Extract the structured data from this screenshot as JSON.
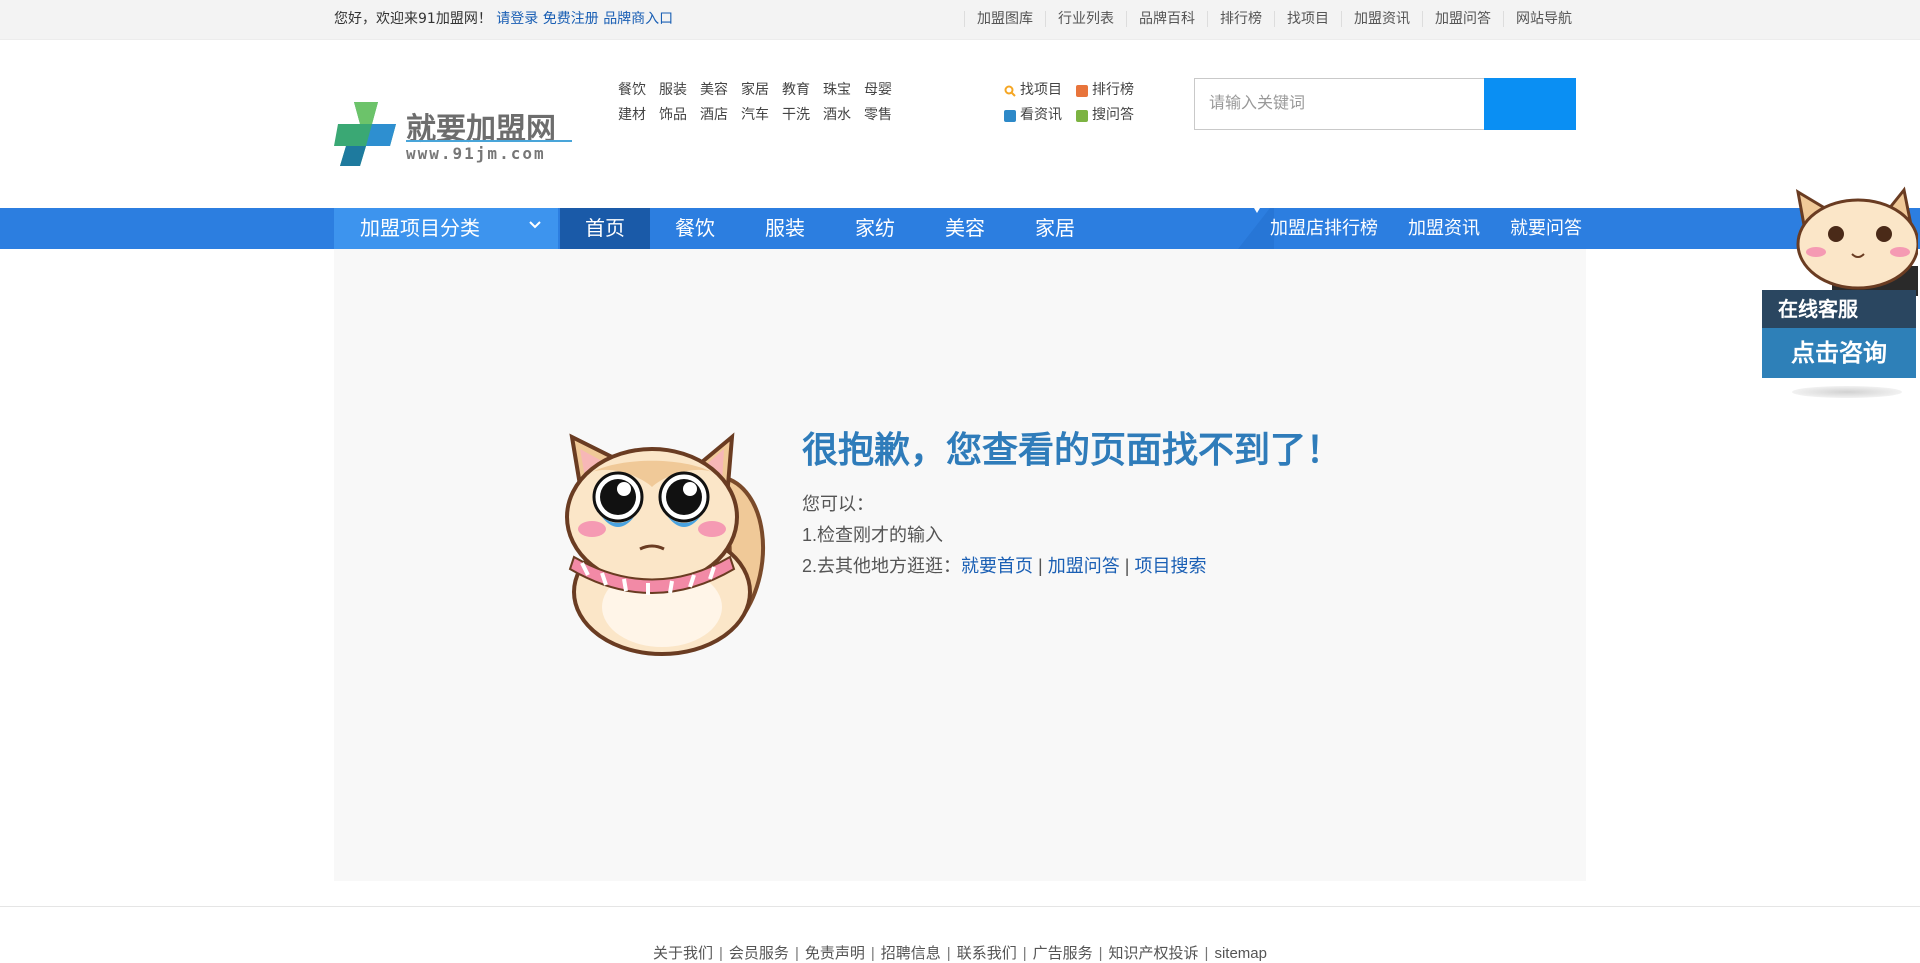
{
  "topbar": {
    "greeting": "您好，欢迎来91加盟网！",
    "login": "请登录",
    "register": "免费注册",
    "brand_entry": "品牌商入口",
    "links": [
      "加盟图库",
      "行业列表",
      "品牌百科",
      "排行榜",
      "找项目",
      "加盟资讯",
      "加盟问答",
      "网站导航"
    ]
  },
  "logo": {
    "text": "就要加盟网",
    "url": "www.91jm.com"
  },
  "categories": {
    "row1": [
      "餐饮",
      "服装",
      "美容",
      "家居",
      "教育",
      "珠宝",
      "母婴"
    ],
    "row2": [
      "建材",
      "饰品",
      "酒店",
      "汽车",
      "干洗",
      "酒水",
      "零售"
    ]
  },
  "quick_links": {
    "find_project": "找项目",
    "ranking": "排行榜",
    "news": "看资讯",
    "qa": "搜问答",
    "icon_colors": [
      "#f5a623",
      "#e8743b",
      "#2d89c8",
      "#7cb342"
    ]
  },
  "search": {
    "placeholder": "请输入关键词",
    "button_color": "#0a8ff3"
  },
  "nav": {
    "category_menu": "加盟项目分类",
    "items": [
      "首页",
      "餐饮",
      "服装",
      "家纺",
      "美容",
      "家居"
    ],
    "active_index": 0,
    "right_items": [
      "加盟店排行榜",
      "加盟资讯",
      "就要问答"
    ]
  },
  "error": {
    "title": "很抱歉，您查看的页面找不到了！",
    "intro": "您可以：",
    "step1": "1.检查刚才的输入",
    "step2_prefix": "2.去其他地方逛逛：",
    "link_home": "就要首页",
    "link_qa": "加盟问答",
    "link_search": "项目搜索",
    "separator": "|"
  },
  "footer": {
    "links": [
      "关于我们",
      "会员服务",
      "免责声明",
      "招聘信息",
      "联系我们",
      "广告服务",
      "知识产权投诉",
      "sitemap"
    ],
    "separator": "|"
  },
  "service": {
    "label": "在线客服",
    "cta": "点击咨询"
  }
}
